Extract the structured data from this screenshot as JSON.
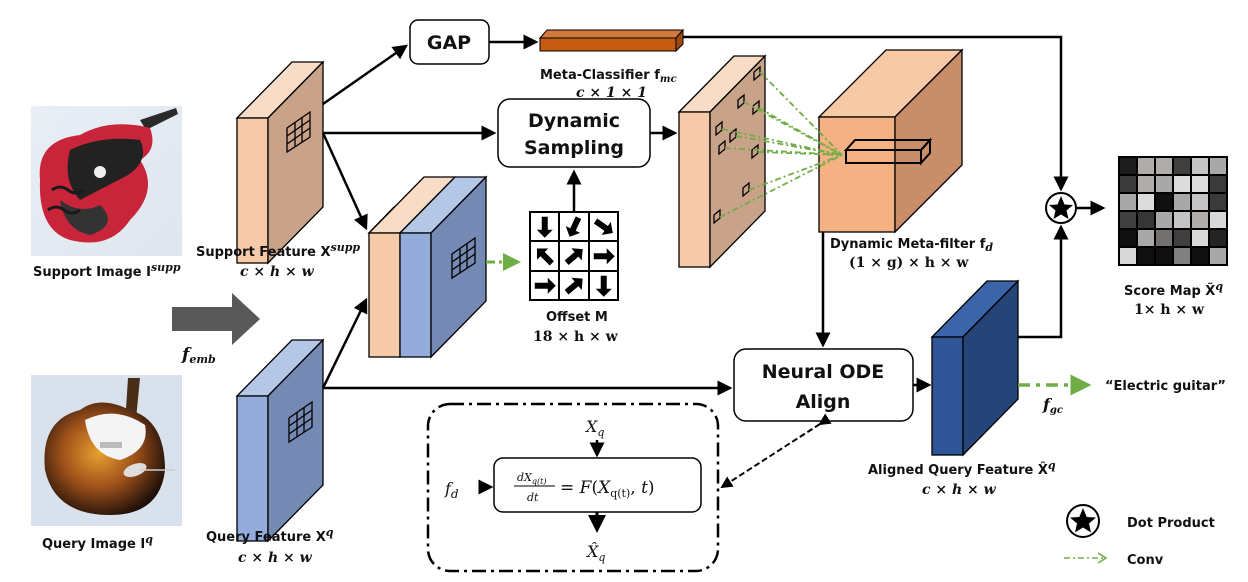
{
  "colors": {
    "support": "#f6c9a8",
    "support_side": "#c9a28a",
    "query": "#93acdc",
    "query_side": "#7489b3",
    "aligned": "#2f5597",
    "aligned_side": "#254579",
    "meta_classifier": "#c55a11",
    "meta_filter": "#f4b183",
    "meta_filter_side": "#c88e6a",
    "conv_green": "#70ad47",
    "femb_arrow": "#595959"
  },
  "labels": {
    "support_image": "Support Image I",
    "support_image_sup": "supp",
    "query_image": "Query Image I",
    "query_image_sup": "q",
    "support_feature": "Support Feature X",
    "support_feature_sup": "supp",
    "support_feature_dim": "c × h × w",
    "query_feature": "Query Feature X",
    "query_feature_sup": "q",
    "query_feature_dim": "c × h × w",
    "f_emb": "f",
    "f_emb_sub": "emb",
    "gap": "GAP",
    "meta_classifier": "Meta-Classifier f",
    "meta_classifier_sub": "mc",
    "meta_classifier_dim": "c × 1 × 1",
    "dynamic_sampling_line1": "Dynamic",
    "dynamic_sampling_line2": "Sampling",
    "offset": "Offset M",
    "offset_dim": "18 × h × w",
    "meta_filter": "Dynamic Meta-filter f",
    "meta_filter_sub": "d",
    "meta_filter_dim": "(1 × g) × h × w",
    "ode_line1": "Neural ODE",
    "ode_line2": "Align",
    "aligned_feature": "Aligned Query Feature X̂",
    "aligned_feature_sup": "q",
    "aligned_feature_dim": "c × h × w",
    "f_gc": "f",
    "f_gc_sub": "gc",
    "class_output": "“Electric guitar”",
    "score_map": "Score Map X̃",
    "score_map_sup": "q",
    "score_map_dim": "1× h × w",
    "ode_inset_input": "X",
    "ode_inset_input_sub": "q",
    "ode_inset_fd": "f",
    "ode_inset_fd_sub": "d",
    "ode_inset_equation": "dX_q(t)/dt = F(X_q(t), t)",
    "ode_inset_output": "X̂",
    "ode_inset_output_sub": "q",
    "legend_dot_product": "Dot Product",
    "legend_conv": "Conv"
  },
  "offset_grid_directions": [
    "down",
    "down-left",
    "down-right",
    "up-left",
    "up-right",
    "right",
    "right",
    "up-right",
    "down"
  ],
  "score_map_gray": [
    [
      "#1c1c1c",
      "#b0acaa",
      "#b0acaa",
      "#404040",
      "#c4c4c4",
      "#a8a8a8"
    ],
    [
      "#3a3a3a",
      "#b0acaa",
      "#a8a8a8",
      "#dcdcdc",
      "#dcdcdc",
      "#3a3a3a"
    ],
    [
      "#a8a8a8",
      "#dcdcdc",
      "#101010",
      "#a8a8a8",
      "#c4c4c4",
      "#3a3a3a"
    ],
    [
      "#404040",
      "#363636",
      "#a8a8a8",
      "#c4c4c4",
      "#b0acaa",
      "#d8d8d8"
    ],
    [
      "#101010",
      "#a8a8a8",
      "#747070",
      "#404040",
      "#d8d8d8",
      "#242424"
    ],
    [
      "#d8d8d8",
      "#101010",
      "#101010",
      "#808080",
      "#101010",
      "#a8a8a8"
    ]
  ]
}
